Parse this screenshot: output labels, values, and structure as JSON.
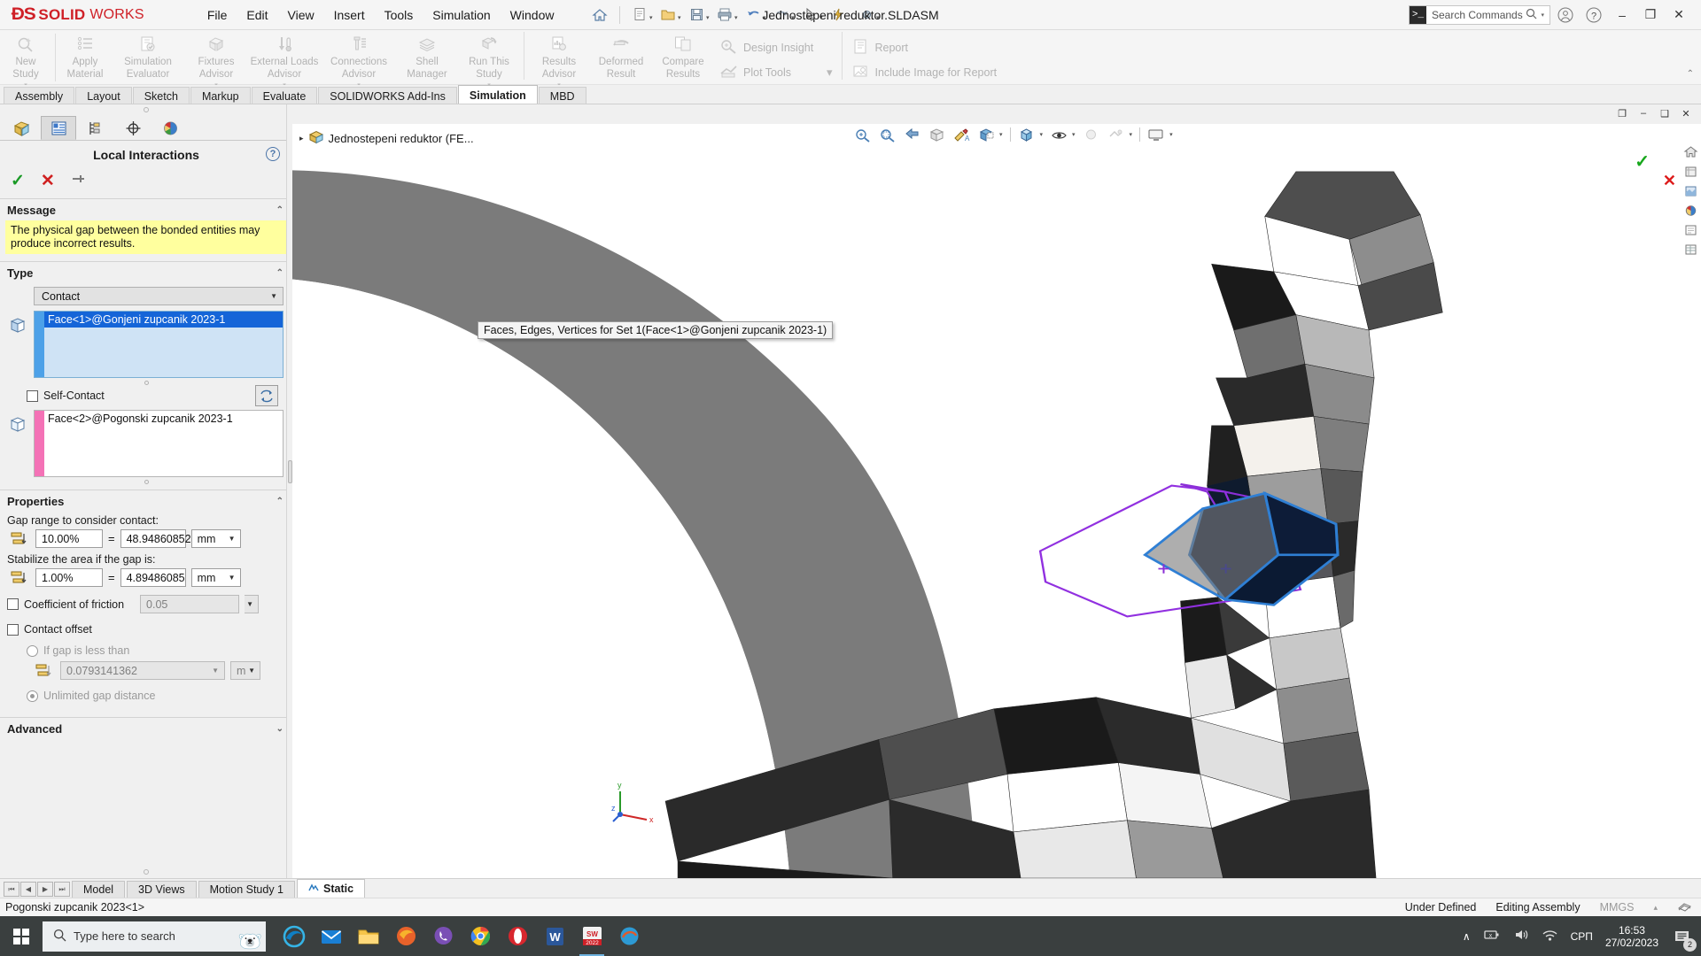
{
  "titlebar": {
    "logo_ds": "ĐS",
    "logo_solid": "SOLID",
    "logo_works": "WORKS",
    "document_title": "Jednostepeni reduktor.SLDASM",
    "menus": [
      "File",
      "Edit",
      "View",
      "Insert",
      "Tools",
      "Simulation",
      "Window"
    ],
    "search_placeholder": "Search Commands",
    "quick_icons": [
      "new-document-icon",
      "open-folder-icon",
      "save-icon",
      "print-icon",
      "undo-icon",
      "redo-icon",
      "select-icon",
      "rebuild-icon",
      "options-gear-icon",
      "home-icon",
      "pin-icon"
    ],
    "window_minimize": "–",
    "window_restore": "❐",
    "window_close": "✕"
  },
  "ribbon": {
    "groups": [
      {
        "buttons": [
          {
            "label_line1": "New",
            "label_line2": "Study",
            "icon": "new-study-icon",
            "has_dropdown": true
          },
          {
            "label_line1": "Apply",
            "label_line2": "Material",
            "icon": "apply-material-icon",
            "has_dropdown": false
          },
          {
            "label_line1": "Simulation",
            "label_line2": "Evaluator",
            "icon": "simulation-evaluator-icon",
            "has_dropdown": false
          },
          {
            "label_line1": "Fixtures",
            "label_line2": "Advisor",
            "icon": "fixtures-advisor-icon",
            "has_dropdown": true
          },
          {
            "label_line1": "External Loads",
            "label_line2": "Advisor",
            "icon": "external-loads-advisor-icon",
            "has_dropdown": true
          },
          {
            "label_line1": "Connections",
            "label_line2": "Advisor",
            "icon": "connections-advisor-icon",
            "has_dropdown": true
          },
          {
            "label_line1": "Shell",
            "label_line2": "Manager",
            "icon": "shell-manager-icon",
            "has_dropdown": false
          },
          {
            "label_line1": "Run This",
            "label_line2": "Study",
            "icon": "run-this-study-icon",
            "has_dropdown": true
          }
        ]
      },
      {
        "buttons": [
          {
            "label_line1": "Results",
            "label_line2": "Advisor",
            "icon": "results-advisor-icon",
            "has_dropdown": true
          },
          {
            "label_line1": "Deformed",
            "label_line2": "Result",
            "icon": "deformed-result-icon",
            "has_dropdown": false
          },
          {
            "label_line1": "Compare",
            "label_line2": "Results",
            "icon": "compare-results-icon",
            "has_dropdown": false
          }
        ],
        "stacked": [
          {
            "label": "Design Insight",
            "icon": "design-insight-icon"
          },
          {
            "label": "Plot Tools",
            "icon": "plot-tools-icon",
            "has_dropdown": true
          }
        ]
      },
      {
        "stacked": [
          {
            "label": "Report",
            "icon": "report-icon"
          },
          {
            "label": "Include Image for Report",
            "icon": "include-image-icon"
          }
        ]
      }
    ]
  },
  "command_tabs": {
    "tabs": [
      "Assembly",
      "Layout",
      "Sketch",
      "Markup",
      "Evaluate",
      "SOLIDWORKS Add-Ins",
      "Simulation",
      "MBD"
    ],
    "active": "Simulation"
  },
  "left_panel": {
    "tabs": [
      {
        "name": "feature-manager-tab",
        "icon": "feature-tree-icon",
        "active": false
      },
      {
        "name": "property-manager-tab",
        "icon": "property-manager-icon",
        "active": true
      },
      {
        "name": "configuration-manager-tab",
        "icon": "configuration-icon",
        "active": false
      },
      {
        "name": "dimxpert-manager-tab",
        "icon": "dimxpert-icon",
        "active": false
      },
      {
        "name": "display-manager-tab",
        "icon": "appearance-sphere-icon",
        "active": false
      }
    ],
    "title": "Local Interactions",
    "help_icon": "?",
    "accept_icon": "✓",
    "cancel_icon": "✕",
    "pin_icon": "⚑",
    "sections": {
      "message": {
        "header": "Message",
        "text": "The physical gap between the bonded entities may produce incorrect results."
      },
      "type": {
        "header": "Type",
        "selected": "Contact",
        "set1_selection": "Face<1>@Gonjeni zupcanik 2023-1",
        "self_contact_label": "Self-Contact",
        "self_contact_checked": false,
        "set2_selection": "Face<2>@Pogonski zupcanik 2023-1",
        "swap_icon": "swap-sets-icon"
      },
      "properties": {
        "header": "Properties",
        "gap_range_label": "Gap range to consider contact:",
        "gap_range_percent": "10.00%",
        "gap_range_equals": "=",
        "gap_range_value": "48.94860852",
        "gap_range_unit": "mm",
        "stabilize_label": "Stabilize the area if the gap is:",
        "stabilize_percent": "1.00%",
        "stabilize_equals": "=",
        "stabilize_value": "4.89486085",
        "stabilize_unit": "mm",
        "friction_label": "Coefficient of friction",
        "friction_checked": false,
        "friction_value": "0.05",
        "contact_offset_label": "Contact offset",
        "contact_offset_checked": false,
        "if_gap_less_label": "If gap is less than",
        "if_gap_less_selected": false,
        "gap_distance_value": "0.0793141362",
        "gap_distance_unit": "m",
        "unlimited_gap_label": "Unlimited gap distance",
        "unlimited_gap_selected": true
      },
      "advanced": {
        "header": "Advanced"
      }
    }
  },
  "graphics": {
    "tree_root": "Jednostepeni reduktor (FE...",
    "tree_arrow": "▸",
    "view_tools": [
      "zoom-to-fit-icon",
      "zoom-to-area-icon",
      "previous-view-icon",
      "section-view-icon",
      "view-orientation-icon",
      "display-style-icon",
      "hide-show-items-icon",
      "edit-appearance-icon",
      "apply-scene-icon",
      "view-settings-icon"
    ],
    "window_controls": [
      "❐",
      "–",
      "❑",
      "✕"
    ],
    "right_icons": [
      "home-view-icon",
      "view-orientation-cube-icon",
      "appearances-icon",
      "scenes-icon",
      "decals-icon",
      "custom-properties-icon"
    ],
    "tooltip": "Faces, Edges, Vertices for Set 1(Face<1>@Gonjeni zupcanik 2023-1)",
    "triad_labels": {
      "x": "x",
      "y": "y",
      "z": "z"
    },
    "confirm_check": "✓",
    "confirm_x": "✕"
  },
  "bottom_tabs": {
    "nav": [
      "⏮",
      "◀",
      "▶",
      "⏭"
    ],
    "tabs": [
      {
        "label": "Model",
        "active": false,
        "icon": ""
      },
      {
        "label": "3D Views",
        "active": false,
        "icon": ""
      },
      {
        "label": "Motion Study 1",
        "active": false,
        "icon": ""
      },
      {
        "label": "Static",
        "active": true,
        "icon": "simulation-study-icon"
      }
    ]
  },
  "statusbar": {
    "left": "Pogonski zupcanik 2023<1>",
    "under_defined": "Under Defined",
    "editing": "Editing Assembly",
    "units": "MMGS",
    "caret": "▴",
    "overlay_icon": "overlay-icon"
  },
  "taskbar": {
    "start_icon": "windows-start-icon",
    "search_placeholder": "Type here to search",
    "search_icon": "search-magnifier-icon",
    "cortana_icon": "polar-bear-icon",
    "apps": [
      {
        "name": "microsoft-edge-icon",
        "color": "#2b7cd3"
      },
      {
        "name": "mail-icon",
        "color": "#1a7fd4"
      },
      {
        "name": "file-explorer-icon",
        "color": "#f5c44a"
      },
      {
        "name": "firefox-icon",
        "color": "#e8622a"
      },
      {
        "name": "viber-icon",
        "color": "#7a4fb5"
      },
      {
        "name": "google-chrome-icon",
        "color": "#4285f4"
      },
      {
        "name": "opera-icon",
        "color": "#d8272e"
      },
      {
        "name": "word-icon",
        "color": "#2b579a"
      },
      {
        "name": "solidworks-icon",
        "color": "#cf2027",
        "active": true
      },
      {
        "name": "solidworks-simulation-icon",
        "color": "#e05a2b"
      }
    ],
    "tray": {
      "chevron": "∧",
      "language": "СРП",
      "time": "16:53",
      "date": "27/02/2023",
      "notification_count": "2"
    }
  }
}
